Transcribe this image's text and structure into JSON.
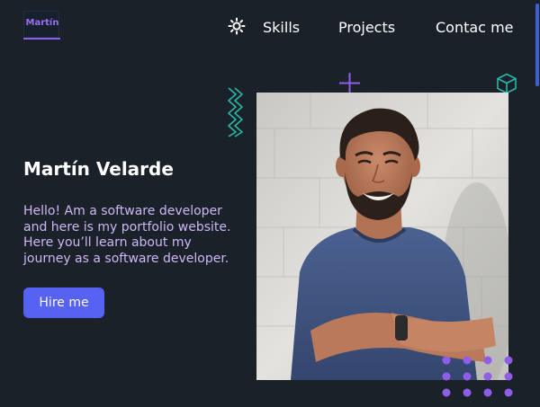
{
  "header": {
    "logo_text": "Martín",
    "theme_toggle_icon": "sun-icon",
    "nav": {
      "skills": "Skills",
      "projects": "Projects",
      "contact": "Contac me"
    }
  },
  "hero": {
    "name": "Martín Velarde",
    "bio": "Hello! Am a software developer and here is my portfolio website. Here you’ll learn about my journey as a software developer.",
    "hire_button": "Hire me"
  },
  "colors": {
    "background": "#1b2129",
    "accent_purple": "#8f5de8",
    "accent_teal": "#2bb6a8",
    "button": "#5662f2",
    "bio_text": "#cdb7f5"
  },
  "decorations": {
    "zigzag": "zigzag-icon",
    "plus": "plus-icon",
    "cube": "cube-icon",
    "dots": "dot-grid-icon"
  }
}
